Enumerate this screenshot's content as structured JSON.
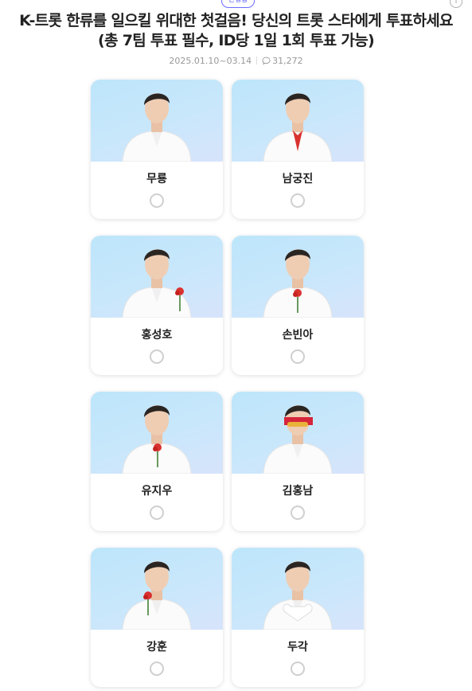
{
  "header": {
    "badge": "진행중",
    "title": "K-트롯 한류를 일으킬 위대한 첫걸음! 당신의 트롯 스타에게 투표하세요 (총 7팀 투표 필수, ID당 1일 1회 투표 가능)",
    "period": "2025.01.10~03.14",
    "comment_count": "31,272",
    "info_icon": "info-icon"
  },
  "candidates": [
    {
      "name": "무룡",
      "selected": false
    },
    {
      "name": "남궁진",
      "selected": false
    },
    {
      "name": "홍성호",
      "selected": false
    },
    {
      "name": "손빈아",
      "selected": false
    },
    {
      "name": "유지우",
      "selected": false
    },
    {
      "name": "김홍남",
      "selected": false
    },
    {
      "name": "강훈",
      "selected": false
    },
    {
      "name": "두각",
      "selected": false
    }
  ],
  "colors": {
    "accent": "#5a5af0",
    "photo_bg": "#c4e6fb",
    "radio_border": "#cfcfcf"
  }
}
